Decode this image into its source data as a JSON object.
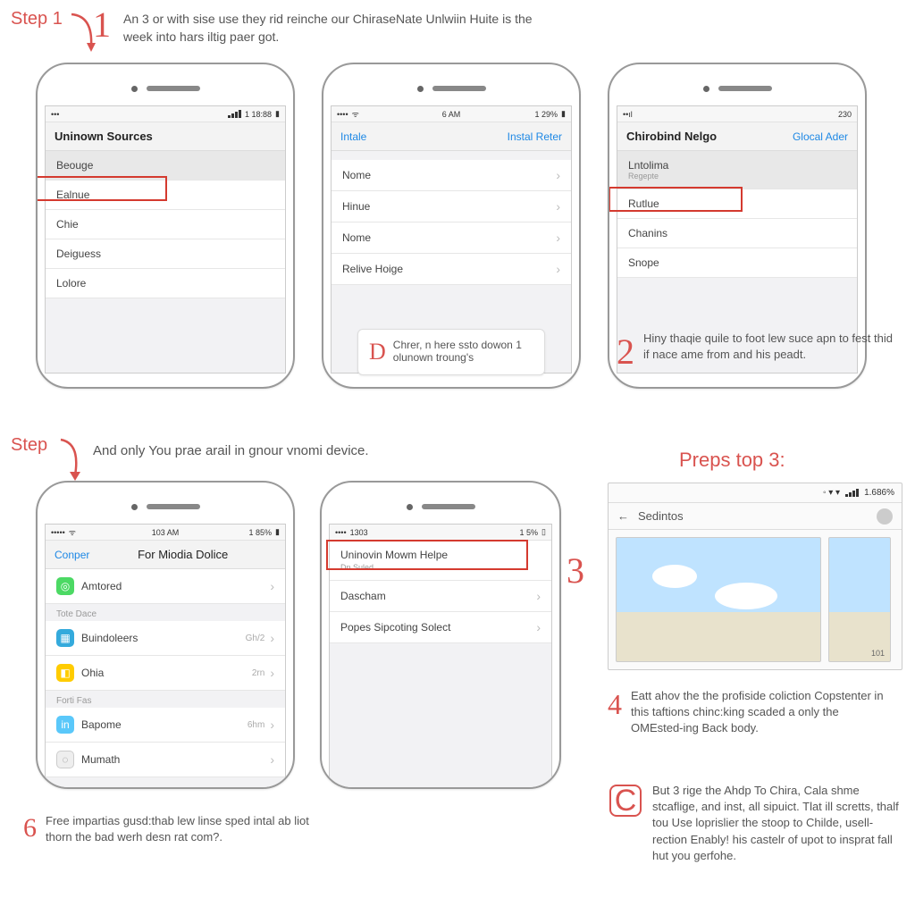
{
  "top": {
    "step1_label": "Step 1",
    "step1_big": "1",
    "step1_text": "An 3 or with sise use they rid reinche our ChiraseNate Unlwiin Huite is the week into hars iltig paer got."
  },
  "phone1": {
    "status_time": "1 18:88",
    "header": "Uninown Sources",
    "rows": [
      "Beouge",
      "Ealnue",
      "Chie",
      "Deiguess",
      "Lolore"
    ]
  },
  "phone2": {
    "status_time": "6 AM",
    "status_right": "1  29%",
    "left_action": "Intale",
    "right_action": "Instal Reter",
    "rows": [
      "Nome",
      "Hinue",
      "Nome",
      "Relive Hoige"
    ]
  },
  "note1": {
    "badge": "D",
    "text": "Chrer, n here ssto dowon 1 olunown troung's"
  },
  "phone3": {
    "status_time": "230",
    "header": "Chirobind Nelgo",
    "action": "Glocal Ader",
    "rows": [
      {
        "label": "Lntolima",
        "sub": "Regepte"
      },
      {
        "label": "Rutlue"
      },
      {
        "label": "Chanins"
      },
      {
        "label": "Snope"
      }
    ]
  },
  "note2": {
    "badge": "2",
    "text": "Hiny thaqie quile to foot lew suce apn to fest thid if nace ame from and his peadt."
  },
  "mid": {
    "step_label": "Step",
    "step_text": "And only You prae arail in gnour vnomi device."
  },
  "phone4": {
    "status_time": "103 AM",
    "status_right": "1  85%",
    "left_action": "Conper",
    "title": "For Miodia Dolice",
    "section1": "",
    "rows1": [
      {
        "icon": "#4cd964",
        "label": "Amtored"
      }
    ],
    "section2": "Tote Dace",
    "rows2": [
      {
        "icon": "#34aadc",
        "label": "Buindoleers",
        "meta": "Gh/⁠2"
      },
      {
        "icon": "#ffcc00",
        "label": "Ohia",
        "meta": "2rn"
      }
    ],
    "section3": "Forti Fas",
    "rows3": [
      {
        "icon": "#5ac8fa",
        "label": "Bapome",
        "meta": "6hm"
      },
      {
        "icon": "#ffffff",
        "label": "Mumath",
        "meta": ""
      }
    ]
  },
  "phone5": {
    "status_left": "1303",
    "status_right": "1  5%",
    "rows": [
      {
        "label": "Uninovin Mowm Helpe",
        "sub": "Dn Suled"
      },
      {
        "label": "Dascham"
      },
      {
        "label": "Popes Sipcoting Solect"
      }
    ]
  },
  "note3_badge": "3",
  "preps_title": "Preps top 3:",
  "browser": {
    "status_right": "1.686%",
    "back": "←",
    "title": "Sedintos",
    "thumb_label": "101"
  },
  "note4": {
    "badge": "4",
    "text": "Eatt ahov the the profiside coliction Copstenter in this taftions chinc:king scaded a only the OMEsted-ing Back body."
  },
  "note5": {
    "badge": "C",
    "text": "But 3 rige the Ahdp To Chira, Cala shme stcaflige, and inst, all sipuict. Tlat ill scretts, thalf tou Use loprislier the stoop to Childe, usell-rection Enably! his castelr of upot to insprat fall hut you gerfohe."
  },
  "note6": {
    "badge": "6",
    "text": "Free impartias gusd:thab lew linse sped intal ab liot thorn the bad werh desn rat com?."
  }
}
